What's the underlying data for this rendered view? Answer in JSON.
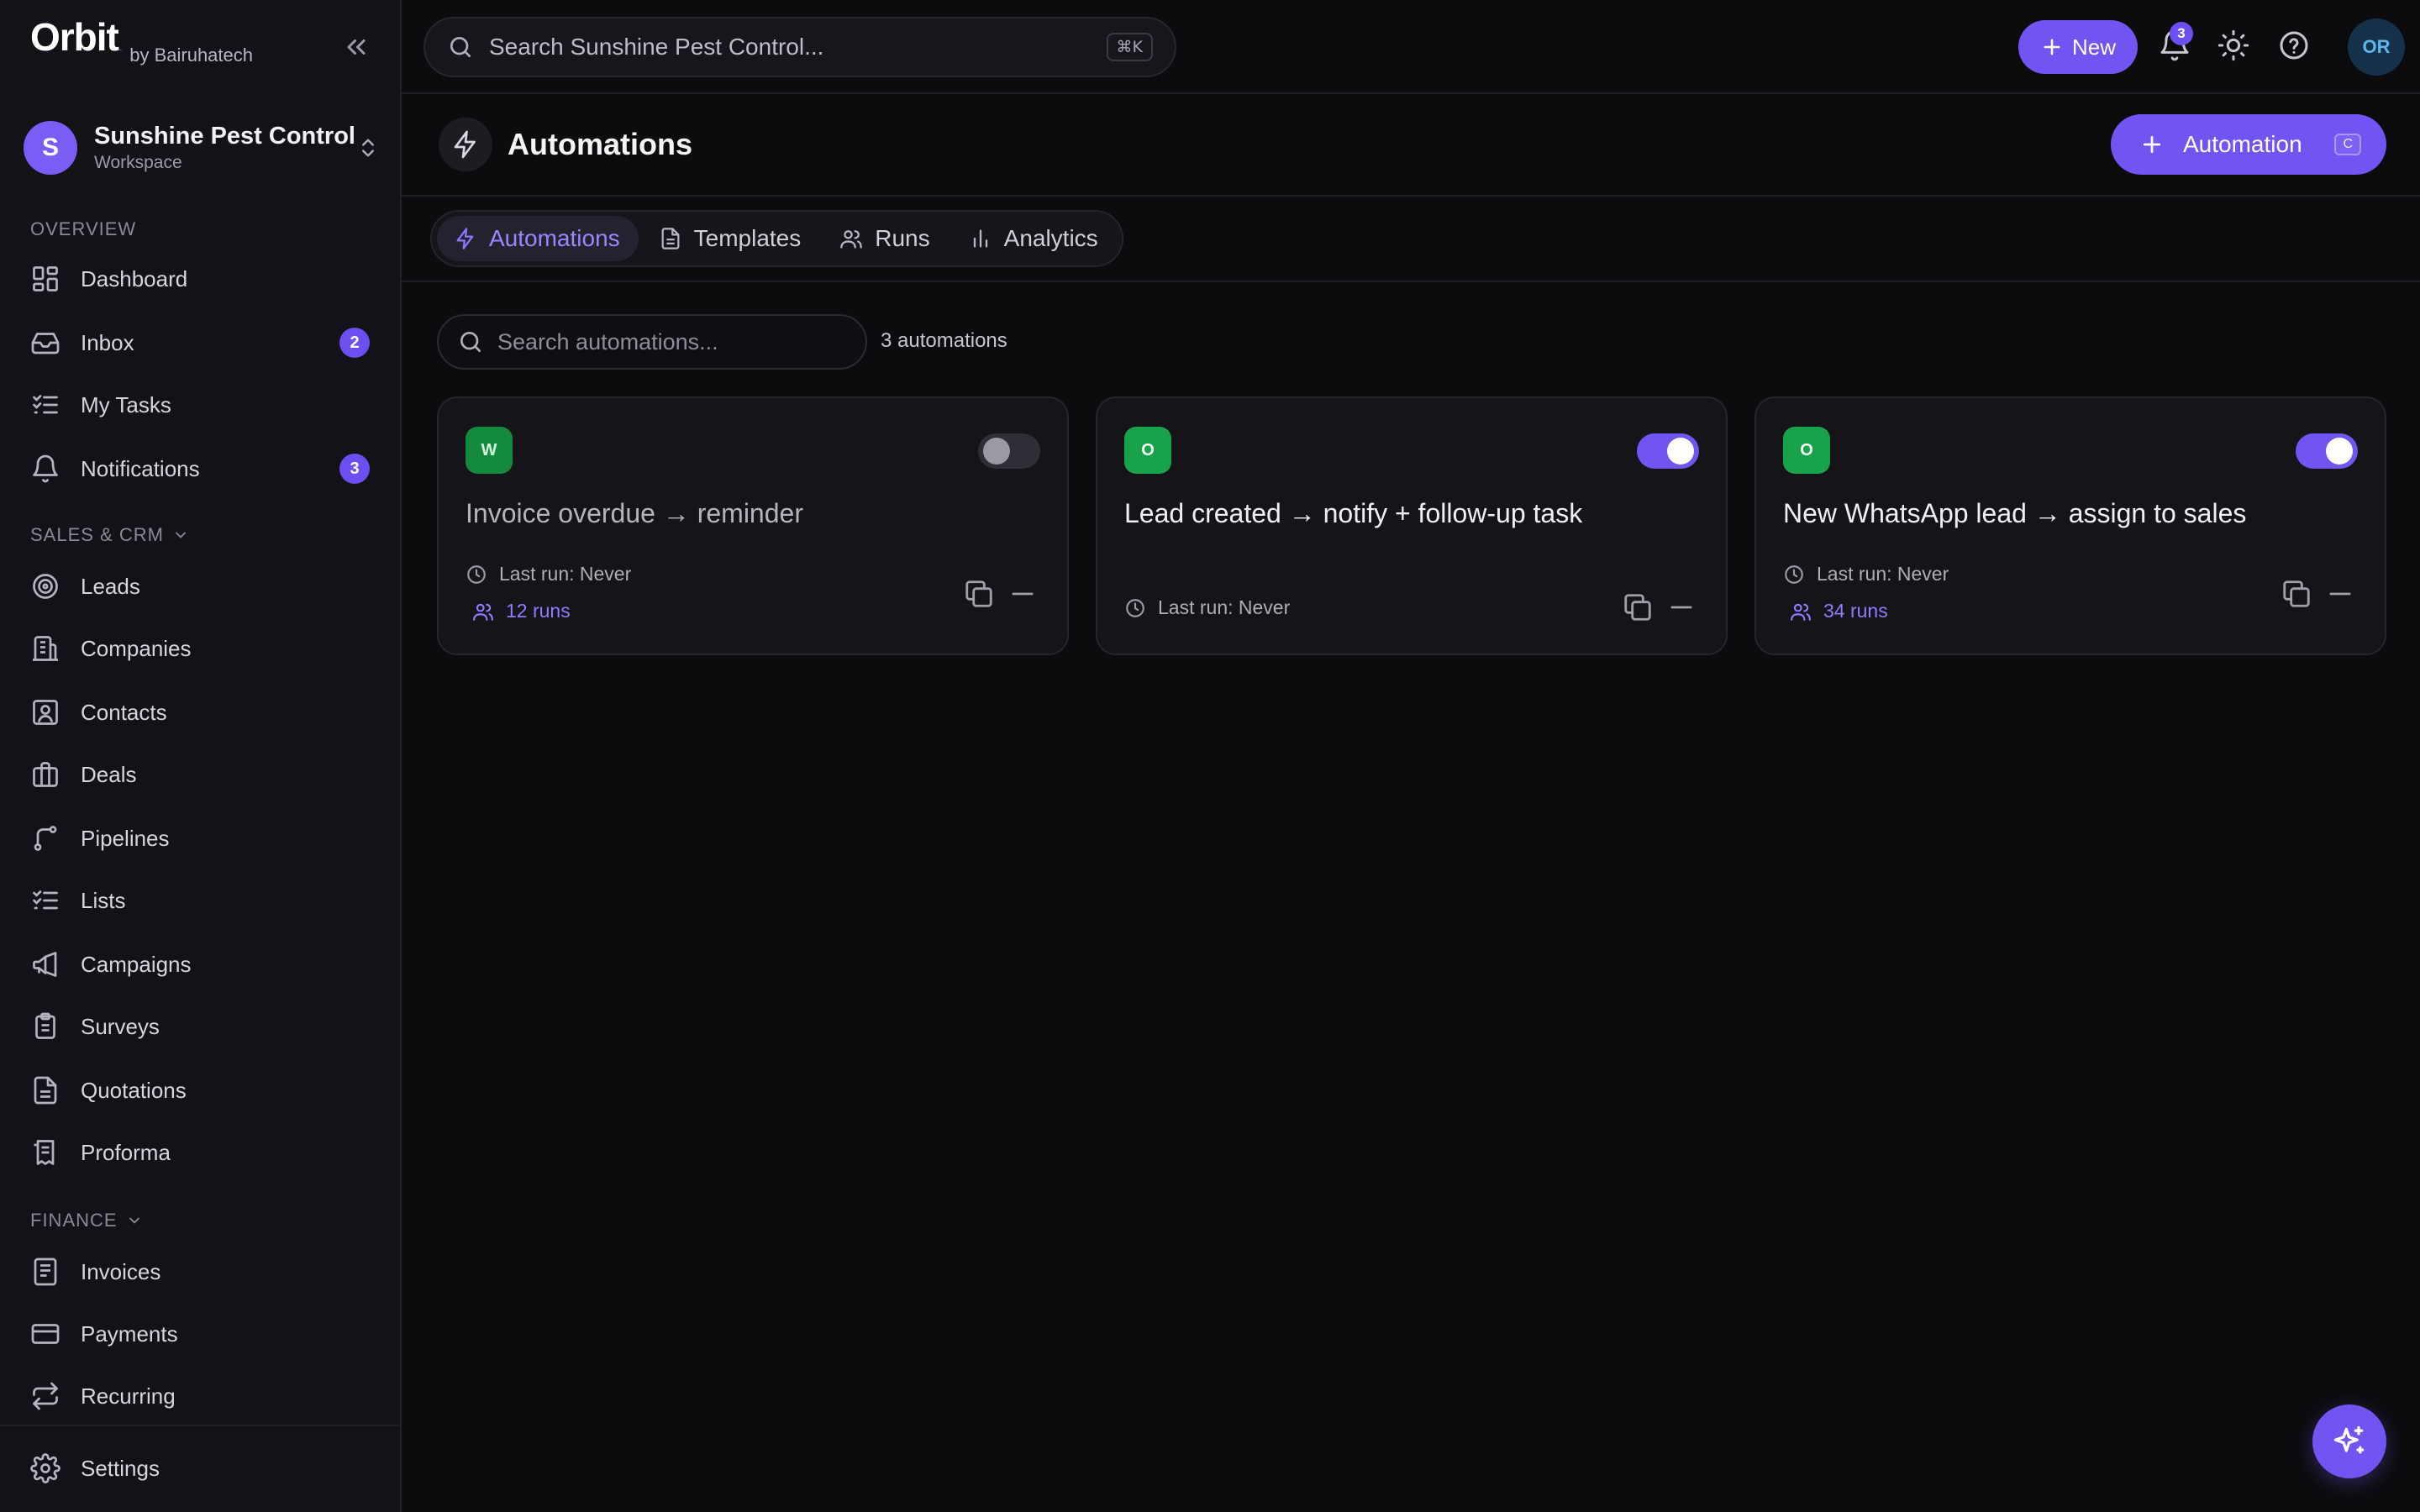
{
  "sidebar": {
    "brand": {
      "logo_text": "Orbit",
      "logo_small": "...",
      "by": "by Bairuhatech"
    },
    "workspace": {
      "avatar_letter": "S",
      "name": "Sunshine Pest Control",
      "subtitle": "Workspace"
    },
    "sections": {
      "overview": "OVERVIEW",
      "sales_crm": "SALES & CRM",
      "finance": "FINANCE"
    },
    "items": [
      {
        "label": "Dashboard",
        "icon": "dashboard-icon"
      },
      {
        "label": "Inbox",
        "icon": "inbox-icon",
        "badge": "2"
      },
      {
        "label": "My Tasks",
        "icon": "tasks-icon"
      },
      {
        "label": "Notifications",
        "icon": "bell-icon",
        "badge": "3"
      },
      {
        "label": "Leads",
        "icon": "target-icon"
      },
      {
        "label": "Companies",
        "icon": "building-icon"
      },
      {
        "label": "Contacts",
        "icon": "contact-icon"
      },
      {
        "label": "Deals",
        "icon": "briefcase-icon"
      },
      {
        "label": "Pipelines",
        "icon": "pipeline-icon"
      },
      {
        "label": "Lists",
        "icon": "list-icon"
      },
      {
        "label": "Campaigns",
        "icon": "megaphone-icon"
      },
      {
        "label": "Surveys",
        "icon": "clipboard-icon"
      },
      {
        "label": "Quotations",
        "icon": "document-icon"
      },
      {
        "label": "Proforma",
        "icon": "receipt-icon"
      },
      {
        "label": "Invoices",
        "icon": "invoice-icon"
      },
      {
        "label": "Payments",
        "icon": "card-icon"
      },
      {
        "label": "Recurring",
        "icon": "repeat-icon"
      }
    ],
    "footer": {
      "label": "Settings",
      "icon": "gear-icon"
    }
  },
  "topbar": {
    "search_placeholder": "Search Sunshine Pest Control...",
    "search_shortcut": "⌘K",
    "new_label": "New",
    "notification_count": "3",
    "user_initials": "OR"
  },
  "page": {
    "title": "Automations",
    "add_button_label": "Automation",
    "add_button_shortcut": "C"
  },
  "tabs": [
    {
      "label": "Automations",
      "icon": "lightning-icon",
      "active": true
    },
    {
      "label": "Templates",
      "icon": "document-icon",
      "active": false
    },
    {
      "label": "Runs",
      "icon": "users-icon",
      "active": false
    },
    {
      "label": "Analytics",
      "icon": "bar-chart-icon",
      "active": false
    }
  ],
  "filter": {
    "search_placeholder": "Search automations...",
    "count_text": "3 automations"
  },
  "automations": [
    {
      "badge": "W",
      "title": "Invoice overdue → reminder",
      "enabled": false,
      "last_run": "Last run: Never",
      "runs": "12 runs"
    },
    {
      "badge": "O",
      "title": "Lead created → notify + follow-up task",
      "enabled": true,
      "last_run": "Last run: Never",
      "runs": ""
    },
    {
      "badge": "O",
      "title": "New WhatsApp lead → assign to sales",
      "enabled": true,
      "last_run": "Last run: Never",
      "runs": "34 runs"
    }
  ],
  "colors": {
    "accent": "#7254f3",
    "accent_text": "#9b86ff",
    "badge_green": "#17a34a",
    "background": "#0c0c0e",
    "sidebar_bg": "#121218"
  }
}
